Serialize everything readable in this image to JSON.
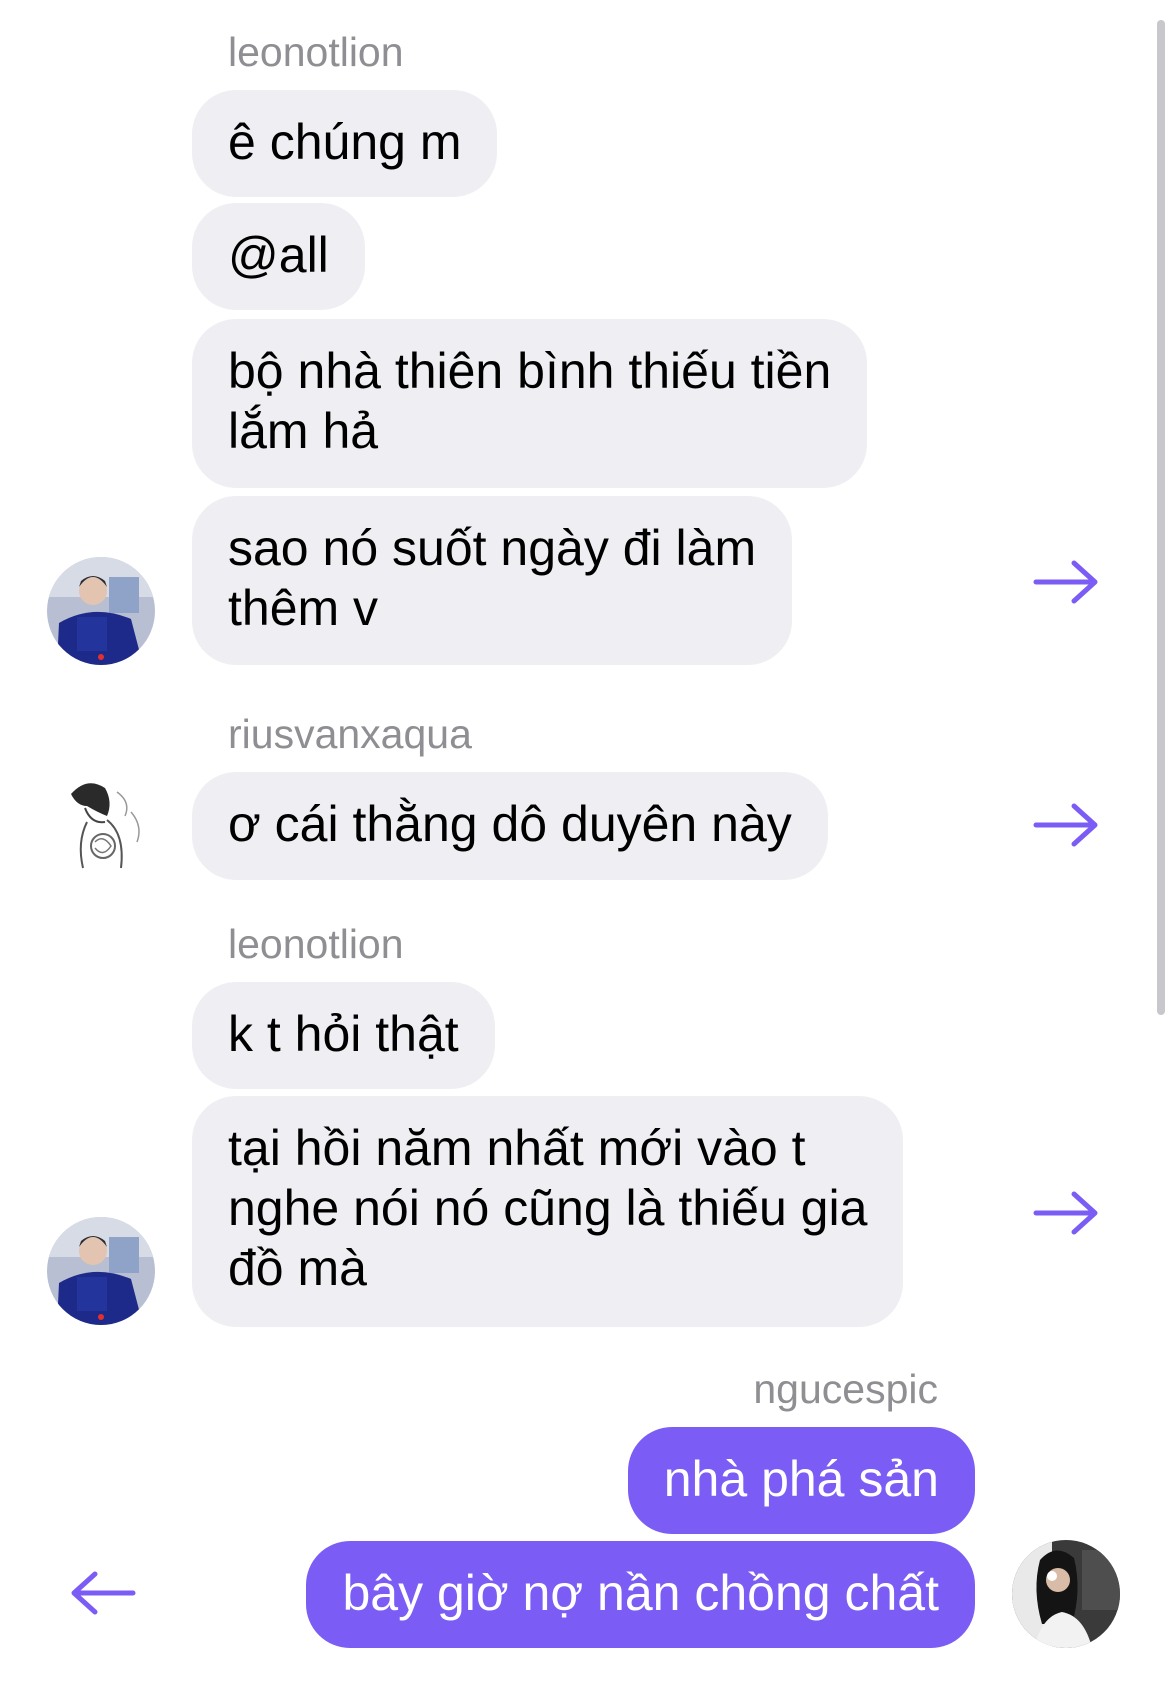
{
  "messages": [
    {
      "sender": "leonotlion",
      "text": "ê chúng m"
    },
    {
      "text": "@all"
    },
    {
      "text": "bộ nhà thiên bình thiếu tiền\nlắm hả"
    },
    {
      "text": "sao nó suốt ngày đi làm\nthêm v"
    },
    {
      "sender": "riusvanxaqua",
      "text": "ơ cái thằng dô duyên này"
    },
    {
      "sender": "leonotlion",
      "text": "k t hỏi thật"
    },
    {
      "text": "tại hồi năm nhất mới vào t\nnghe nói nó cũng là thiếu gia\nđồ mà"
    },
    {
      "sender": "ngucespic",
      "text": "nhà phá sản"
    },
    {
      "text": "bây giờ nợ nần chồng chất"
    }
  ],
  "icons": {
    "forward": "arrow-right-icon",
    "reply": "arrow-left-icon"
  },
  "colors": {
    "incoming_bubble": "#efeff3",
    "outgoing_bubble": "#7b5cf5",
    "accent": "#7b5cf5",
    "sender_name": "#8e8e93"
  }
}
